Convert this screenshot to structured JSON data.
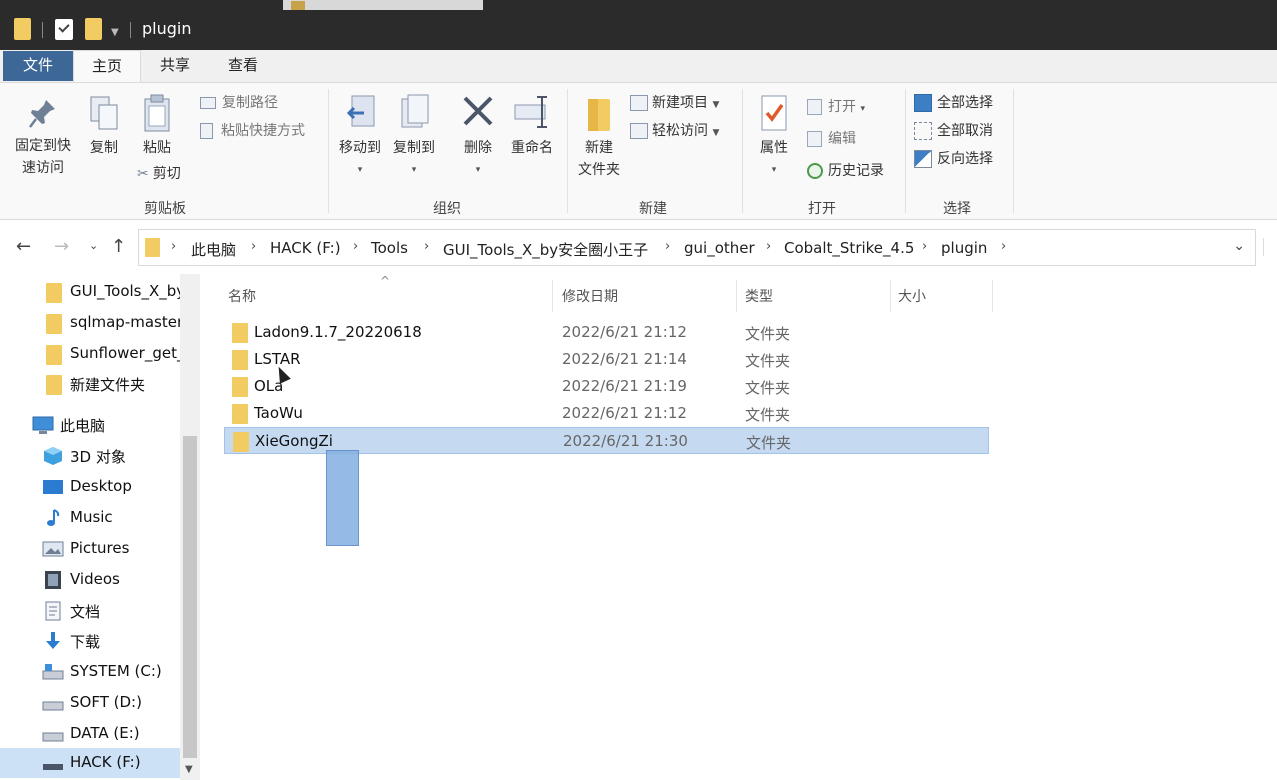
{
  "window": {
    "title": "plugin"
  },
  "tabs": {
    "file": "文件",
    "home": "主页",
    "share": "共享",
    "view": "查看"
  },
  "ribbon": {
    "clipboard": {
      "pin": "固定到快\n速访问",
      "pin_line1": "固定到快",
      "pin_line2": "速访问",
      "copy": "复制",
      "paste": "粘贴",
      "copy_path": "复制路径",
      "paste_shortcut": "粘贴快捷方式",
      "cut": "剪切",
      "label": "剪贴板"
    },
    "organize": {
      "move_to": "移动到",
      "copy_to": "复制到",
      "delete": "删除",
      "rename": "重命名",
      "label": "组织"
    },
    "new": {
      "new_folder_line1": "新建",
      "new_folder_line2": "文件夹",
      "new_item": "新建项目",
      "easy_access": "轻松访问",
      "label": "新建"
    },
    "open": {
      "properties": "属性",
      "open": "打开",
      "edit": "编辑",
      "history": "历史记录",
      "label": "打开"
    },
    "select": {
      "select_all": "全部选择",
      "select_none": "全部取消",
      "invert": "反向选择",
      "label": "选择"
    }
  },
  "address": {
    "crumbs": [
      "此电脑",
      "HACK (F:)",
      "Tools",
      "GUI_Tools_X_by安全圈小王子",
      "gui_other",
      "Cobalt_Strike_4.5",
      "plugin"
    ]
  },
  "sidebar": {
    "quick": [
      "GUI_Tools_X_by",
      "sqlmap-master",
      "Sunflower_get_",
      "新建文件夹"
    ],
    "this_pc": "此电脑",
    "items": [
      {
        "label": "3D 对象",
        "icon": "3d-objects-icon"
      },
      {
        "label": "Desktop",
        "icon": "desktop-icon"
      },
      {
        "label": "Music",
        "icon": "music-icon"
      },
      {
        "label": "Pictures",
        "icon": "pictures-icon"
      },
      {
        "label": "Videos",
        "icon": "videos-icon"
      },
      {
        "label": "文档",
        "icon": "documents-icon"
      },
      {
        "label": "下载",
        "icon": "downloads-icon"
      },
      {
        "label": "SYSTEM (C:)",
        "icon": "drive-icon"
      },
      {
        "label": "SOFT (D:)",
        "icon": "drive-icon"
      },
      {
        "label": "DATA (E:)",
        "icon": "drive-icon"
      },
      {
        "label": "HACK (F:)",
        "icon": "drive-icon"
      }
    ]
  },
  "columns": {
    "name": "名称",
    "date": "修改日期",
    "type": "类型",
    "size": "大小"
  },
  "files": [
    {
      "name": "Ladon9.1.7_20220618",
      "date": "2022/6/21 21:12",
      "type": "文件夹"
    },
    {
      "name": "LSTAR",
      "date": "2022/6/21 21:14",
      "type": "文件夹"
    },
    {
      "name": "OLa",
      "date": "2022/6/21 21:19",
      "type": "文件夹"
    },
    {
      "name": "TaoWu",
      "date": "2022/6/21 21:12",
      "type": "文件夹"
    },
    {
      "name": "XieGongZi",
      "date": "2022/6/21 21:30",
      "type": "文件夹"
    }
  ],
  "colors": {
    "accent": "#3d6797",
    "selection": "#c5daf1",
    "folder": "#f3cb63"
  }
}
